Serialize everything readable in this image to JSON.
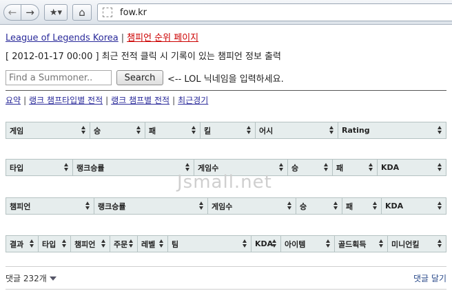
{
  "browser": {
    "back_icon": "←",
    "forward_icon": "→",
    "bookmark_icon": "★▾",
    "home_icon": "⌂",
    "url": "fow.kr"
  },
  "top_links": {
    "site": "League of Legends Korea",
    "separator": "|",
    "ranking": "챔피언 순위 페이지"
  },
  "notice": "[ 2012-01-17 00:00 ] 최근 전적 클릭 시 기록이 있는 챔피언 정보 출력",
  "search": {
    "placeholder": "Find a Summoner..",
    "button": "Search",
    "hint": "<-- LOL 닉네임을 입력하세요."
  },
  "tabs": [
    "요약",
    "랭크 챔프타입별 전적",
    "랭크 챔프별 전적",
    "최근경기"
  ],
  "tables": [
    {
      "columns": [
        {
          "label": "게임",
          "w": 122
        },
        {
          "label": "승",
          "w": 80
        },
        {
          "label": "패",
          "w": 80
        },
        {
          "label": "킬",
          "w": 80
        },
        {
          "label": "어시",
          "w": 120
        },
        {
          "label": "Rating",
          "w": 158
        }
      ]
    },
    {
      "columns": [
        {
          "label": "타입",
          "w": 97
        },
        {
          "label": "랭크승률",
          "w": 176
        },
        {
          "label": "게임수",
          "w": 136
        },
        {
          "label": "승",
          "w": 65
        },
        {
          "label": "패",
          "w": 65
        },
        {
          "label": "KDA",
          "w": 101
        }
      ]
    },
    {
      "columns": [
        {
          "label": "챔피언",
          "w": 128
        },
        {
          "label": "랭크승률",
          "w": 165
        },
        {
          "label": "게임수",
          "w": 128
        },
        {
          "label": "승",
          "w": 67
        },
        {
          "label": "패",
          "w": 57
        },
        {
          "label": "KDA",
          "w": 95
        }
      ]
    },
    {
      "columns": [
        {
          "label": "결과",
          "w": 47
        },
        {
          "label": "타입",
          "w": 47
        },
        {
          "label": "챔피언",
          "w": 57
        },
        {
          "label": "주문",
          "w": 40
        },
        {
          "label": "레벨",
          "w": 44
        },
        {
          "label": "팀",
          "w": 121
        },
        {
          "label": "KDA",
          "w": 43
        },
        {
          "label": "아이템",
          "w": 78
        },
        {
          "label": "골드획득",
          "w": 77
        },
        {
          "label": "미니언킬",
          "w": 86
        }
      ]
    }
  ],
  "watermark": "Jsmall.net",
  "comments": {
    "count": "댓글 232개",
    "write": "댓글 달기"
  }
}
